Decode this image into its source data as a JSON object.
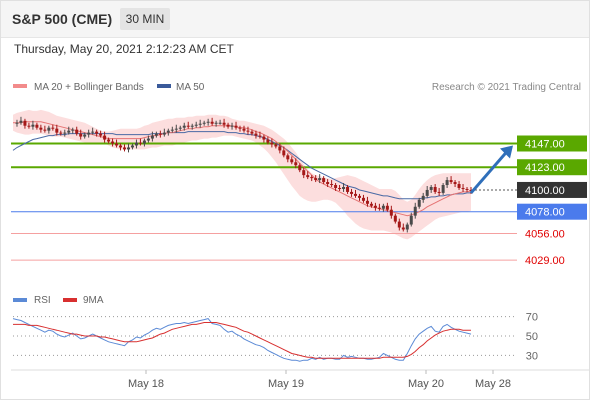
{
  "header": {
    "title": "S&P 500 (CME)",
    "timeframe": "30 MIN"
  },
  "datetime": "Thursday, May 20, 2021 2:12:23 AM CET",
  "legend": {
    "ma20_label": "MA 20 + Bollinger Bands",
    "ma50_label": "MA 50",
    "copyright": "Research © 2021 Trading Central",
    "rsi_label": "RSI",
    "ma9_label": "9MA"
  },
  "colors": {
    "green": "#5aa800",
    "blue": "#4b7bec",
    "red": "#e00000",
    "dark": "#333333",
    "band_fill": "#fcdede",
    "ma20": "#e57373",
    "ma50": "#4a6aa5",
    "candle_up": "#4a4a4a",
    "candle_down": "#a51818",
    "rsi": "#5b8ad6",
    "rsi_ma": "#d83030"
  },
  "chart_data": [
    {
      "type": "candlestick",
      "series": [
        {
          "name": "MA 20 + Bollinger Bands"
        },
        {
          "name": "MA 50"
        }
      ],
      "x_labels": [
        "May 18",
        "May 19",
        "May 20",
        "May 28"
      ],
      "ylim": [
        4018,
        4190
      ],
      "levels": [
        {
          "value": 4147.0,
          "label": "4147.00",
          "kind": "resistance",
          "color": "green",
          "box": true
        },
        {
          "value": 4123.0,
          "label": "4123.00",
          "kind": "resistance",
          "color": "green",
          "box": true
        },
        {
          "value": 4100.0,
          "label": "4100.00",
          "kind": "current",
          "color": "dark",
          "box": true
        },
        {
          "value": 4078.0,
          "label": "4078.00",
          "kind": "support",
          "color": "blue",
          "box": true
        },
        {
          "value": 4056.0,
          "label": "4056.00",
          "kind": "support",
          "color": "red",
          "box": false
        },
        {
          "value": 4029.0,
          "label": "4029.00",
          "kind": "support",
          "color": "red",
          "box": false
        }
      ],
      "close": [
        4167,
        4168,
        4170,
        4165,
        4164,
        4166,
        4163,
        4161,
        4160,
        4163,
        4162,
        4158,
        4157,
        4158,
        4160,
        4161,
        4157,
        4154,
        4156,
        4158,
        4159,
        4157,
        4155,
        4151,
        4149,
        4147,
        4145,
        4143,
        4141,
        4143,
        4145,
        4148,
        4147,
        4150,
        4152,
        4155,
        4157,
        4156,
        4158,
        4160,
        4161,
        4162,
        4163,
        4165,
        4164,
        4165,
        4166,
        4167,
        4168,
        4169,
        4167,
        4168,
        4168,
        4166,
        4164,
        4165,
        4163,
        4162,
        4160,
        4159,
        4157,
        4155,
        4154,
        4151,
        4148,
        4146,
        4144,
        4140,
        4135,
        4131,
        4128,
        4125,
        4120,
        4115,
        4113,
        4112,
        4110,
        4112,
        4108,
        4106,
        4105,
        4102,
        4101,
        4103,
        4098,
        4096,
        4094,
        4092,
        4089,
        4086,
        4084,
        4082,
        4081,
        4084,
        4080,
        4074,
        4068,
        4062,
        4060,
        4065,
        4074,
        4083,
        4090,
        4094,
        4100,
        4103,
        4098,
        4097,
        4105,
        4110,
        4108,
        4106,
        4102,
        4101,
        4100,
        4099
      ],
      "bb_upper": [
        4176,
        4178,
        4179,
        4180,
        4181,
        4180,
        4180,
        4181,
        4180,
        4179,
        4177,
        4175,
        4174,
        4173,
        4172,
        4171,
        4170,
        4169,
        4168,
        4166,
        4164,
        4162,
        4160,
        4159,
        4159,
        4160,
        4161,
        4162,
        4162,
        4162,
        4162,
        4162,
        4163,
        4165,
        4166,
        4168,
        4169,
        4170,
        4171,
        4172,
        4172,
        4173,
        4173,
        4173,
        4174,
        4174,
        4175,
        4175,
        4175,
        4176,
        4176,
        4176,
        4175,
        4175,
        4174,
        4172,
        4171,
        4170,
        4170,
        4169,
        4168,
        4167,
        4166,
        4165,
        4163,
        4161,
        4158,
        4155,
        4152,
        4148,
        4143,
        4138,
        4132,
        4126,
        4121,
        4117,
        4115,
        4114,
        4113,
        4112,
        4111,
        4112,
        4113,
        4114,
        4115,
        4114,
        4113,
        4111,
        4109,
        4107,
        4105,
        4103,
        4101,
        4101,
        4101,
        4101,
        4099,
        4095,
        4090,
        4088,
        4090,
        4095,
        4101,
        4106,
        4110,
        4113,
        4115,
        4116,
        4117,
        4117,
        4117,
        4117,
        4117,
        4117,
        4117,
        4117
      ],
      "ma20": [
        4168,
        4168,
        4168,
        4169,
        4169,
        4169,
        4169,
        4169,
        4168,
        4167,
        4166,
        4165,
        4164,
        4163,
        4162,
        4161,
        4160,
        4159,
        4158,
        4157,
        4156,
        4155,
        4154,
        4153,
        4152,
        4152,
        4152,
        4152,
        4152,
        4152,
        4152,
        4152,
        4152,
        4153,
        4154,
        4155,
        4155,
        4156,
        4157,
        4158,
        4158,
        4159,
        4160,
        4161,
        4162,
        4162,
        4163,
        4163,
        4164,
        4164,
        4165,
        4165,
        4165,
        4165,
        4165,
        4165,
        4164,
        4163,
        4163,
        4162,
        4161,
        4159,
        4158,
        4156,
        4154,
        4152,
        4149,
        4146,
        4143,
        4139,
        4135,
        4131,
        4127,
        4123,
        4119,
        4115,
        4111,
        4108,
        4106,
        4104,
        4102,
        4100,
        4098,
        4096,
        4094,
        4092,
        4090,
        4088,
        4086,
        4084,
        4083,
        4082,
        4081,
        4080,
        4079,
        4078,
        4077,
        4076,
        4075,
        4074,
        4075,
        4076,
        4078,
        4080,
        4083,
        4085,
        4087,
        4089,
        4091,
        4093,
        4095,
        4096,
        4097,
        4098,
        4098,
        4099
      ],
      "bb_lower": [
        4160,
        4158,
        4157,
        4156,
        4156,
        4157,
        4157,
        4157,
        4156,
        4155,
        4154,
        4154,
        4154,
        4153,
        4152,
        4151,
        4150,
        4149,
        4148,
        4147,
        4147,
        4147,
        4147,
        4147,
        4145,
        4143,
        4142,
        4141,
        4141,
        4141,
        4141,
        4141,
        4141,
        4141,
        4142,
        4143,
        4143,
        4144,
        4145,
        4145,
        4145,
        4146,
        4147,
        4148,
        4149,
        4150,
        4150,
        4151,
        4152,
        4152,
        4153,
        4153,
        4154,
        4155,
        4155,
        4155,
        4154,
        4153,
        4152,
        4151,
        4150,
        4148,
        4145,
        4142,
        4138,
        4133,
        4128,
        4122,
        4116,
        4110,
        4104,
        4099,
        4094,
        4091,
        4089,
        4088,
        4088,
        4089,
        4090,
        4090,
        4089,
        4087,
        4083,
        4079,
        4074,
        4070,
        4066,
        4063,
        4061,
        4060,
        4059,
        4059,
        4059,
        4059,
        4058,
        4057,
        4055,
        4053,
        4051,
        4050,
        4052,
        4055,
        4058,
        4061,
        4064,
        4067,
        4070,
        4072,
        4073,
        4074,
        4075,
        4076,
        4077,
        4078,
        4078,
        4079
      ],
      "ma50": [
        4140,
        4143,
        4145,
        4147,
        4149,
        4151,
        4152,
        4153,
        4154,
        4155,
        4155,
        4156,
        4156,
        4156,
        4157,
        4157,
        4157,
        4157,
        4157,
        4157,
        4157,
        4157,
        4157,
        4157,
        4157,
        4157,
        4156,
        4156,
        4156,
        4156,
        4156,
        4156,
        4156,
        4156,
        4156,
        4157,
        4157,
        4157,
        4157,
        4158,
        4158,
        4158,
        4158,
        4158,
        4159,
        4159,
        4159,
        4159,
        4159,
        4159,
        4159,
        4159,
        4159,
        4159,
        4158,
        4158,
        4158,
        4157,
        4157,
        4156,
        4156,
        4155,
        4154,
        4153,
        4151,
        4149,
        4147,
        4145,
        4143,
        4140,
        4137,
        4134,
        4131,
        4128,
        4125,
        4122,
        4120,
        4118,
        4116,
        4114,
        4112,
        4110,
        4108,
        4106,
        4104,
        4103,
        4102,
        4100,
        4099,
        4098,
        4097,
        4096,
        4095,
        4094,
        4094,
        4093,
        4092,
        4091,
        4091,
        4091,
        4091,
        4091,
        4091,
        4092,
        4092,
        4093,
        4093,
        4094,
        4094,
        4095,
        4095,
        4096,
        4096,
        4096,
        4097,
        4097
      ],
      "annotation": "arrow projecting up toward 4147.00"
    },
    {
      "type": "line",
      "series": [
        {
          "name": "RSI"
        },
        {
          "name": "9MA"
        }
      ],
      "ylim": [
        18,
        80
      ],
      "y_ticks": [
        70,
        50,
        30
      ],
      "rsi": [
        68,
        67,
        66,
        64,
        62,
        60,
        58,
        56,
        54,
        56,
        55,
        52,
        50,
        49,
        51,
        53,
        50,
        47,
        48,
        50,
        52,
        50,
        48,
        46,
        44,
        43,
        42,
        41,
        40,
        44,
        46,
        49,
        48,
        51,
        53,
        56,
        58,
        57,
        59,
        61,
        62,
        63,
        63,
        64,
        63,
        64,
        65,
        66,
        67,
        68,
        63,
        62,
        61,
        57,
        54,
        55,
        52,
        50,
        47,
        45,
        43,
        41,
        40,
        38,
        35,
        33,
        31,
        29,
        27,
        26,
        25,
        25,
        24,
        25,
        25,
        27,
        26,
        28,
        26,
        27,
        27,
        26,
        26,
        30,
        28,
        29,
        28,
        27,
        27,
        26,
        26,
        27,
        28,
        32,
        30,
        28,
        26,
        25,
        25,
        32,
        40,
        47,
        52,
        55,
        58,
        60,
        55,
        54,
        60,
        62,
        59,
        57,
        55,
        54,
        53,
        52
      ],
      "rsi_ma": [
        62,
        62,
        62,
        62,
        61,
        61,
        61,
        60,
        59,
        58,
        57,
        56,
        55,
        54,
        53,
        52,
        52,
        51,
        50,
        50,
        50,
        50,
        49,
        49,
        48,
        47,
        46,
        45,
        44,
        44,
        44,
        44,
        45,
        46,
        47,
        48,
        50,
        52,
        53,
        55,
        57,
        58,
        59,
        60,
        61,
        62,
        62,
        63,
        64,
        64,
        64,
        64,
        63,
        62,
        61,
        60,
        59,
        57,
        55,
        54,
        52,
        50,
        48,
        46,
        44,
        42,
        40,
        38,
        36,
        34,
        32,
        31,
        30,
        29,
        28,
        28,
        27,
        27,
        27,
        27,
        27,
        27,
        27,
        27,
        27,
        27,
        27,
        27,
        27,
        27,
        27,
        27,
        27,
        28,
        28,
        28,
        28,
        28,
        28,
        29,
        31,
        34,
        38,
        41,
        45,
        48,
        51,
        53,
        55,
        56,
        57,
        57,
        57,
        56,
        56,
        56
      ]
    }
  ]
}
